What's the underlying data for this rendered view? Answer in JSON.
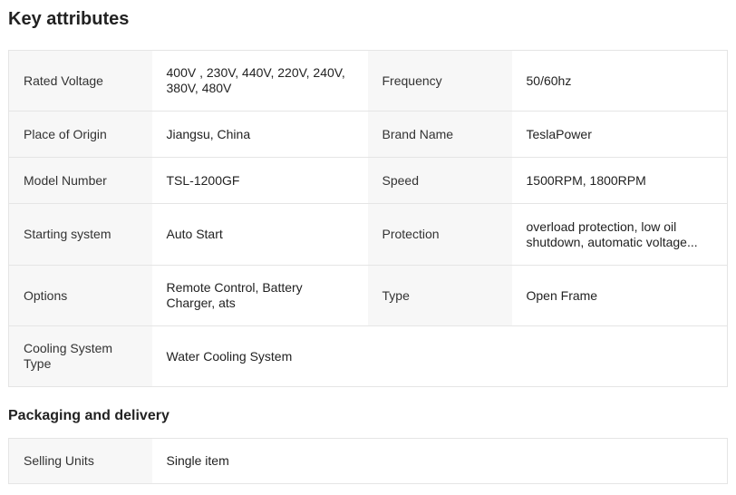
{
  "key_attributes": {
    "title": "Key attributes",
    "rows": [
      [
        {
          "label": "Rated Voltage",
          "value": "400V , 230V, 440V, 220V, 240V, 380V, 480V"
        },
        {
          "label": "Frequency",
          "value": "50/60hz"
        }
      ],
      [
        {
          "label": "Place of Origin",
          "value": "Jiangsu, China"
        },
        {
          "label": "Brand Name",
          "value": "TeslaPower"
        }
      ],
      [
        {
          "label": "Model Number",
          "value": "TSL-1200GF"
        },
        {
          "label": "Speed",
          "value": "1500RPM, 1800RPM"
        }
      ],
      [
        {
          "label": "Starting system",
          "value": "Auto Start"
        },
        {
          "label": "Protection",
          "value": "overload protection, low oil shutdown, automatic voltage..."
        }
      ],
      [
        {
          "label": "Options",
          "value": "Remote Control, Battery Charger, ats"
        },
        {
          "label": "Type",
          "value": "Open Frame"
        }
      ],
      [
        {
          "label": "Cooling System Type",
          "value": "Water Cooling System"
        }
      ]
    ]
  },
  "packaging": {
    "title": "Packaging and delivery",
    "rows": [
      [
        {
          "label": "Selling Units",
          "value": "Single item"
        }
      ]
    ]
  }
}
